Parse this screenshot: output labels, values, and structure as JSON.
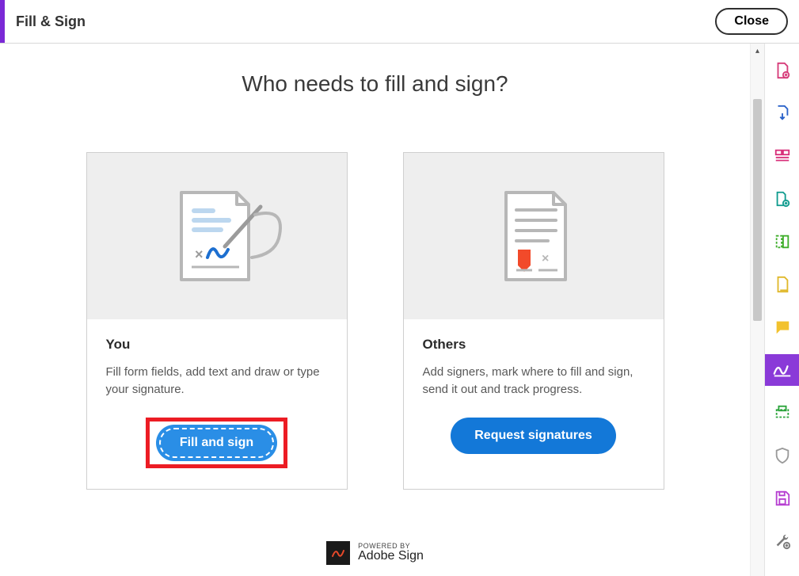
{
  "header": {
    "title": "Fill & Sign",
    "close_label": "Close"
  },
  "main": {
    "heading": "Who needs to fill and sign?",
    "cards": {
      "you": {
        "title": "You",
        "desc": "Fill form fields, add text and draw or type your signature.",
        "button": "Fill and sign"
      },
      "others": {
        "title": "Others",
        "desc": "Add signers, mark where to fill and sign, send it out and track progress.",
        "button": "Request signatures"
      }
    },
    "footer": {
      "powered": "POWERED BY",
      "brand": "Adobe Sign"
    }
  },
  "right_rail": {
    "icons": [
      "create-pdf-icon",
      "export-pdf-icon",
      "organize-pages-icon",
      "combine-files-icon",
      "compress-pdf-icon",
      "edit-pdf-icon",
      "comment-icon",
      "fill-sign-icon",
      "print-production-icon",
      "protect-icon",
      "save-icon",
      "more-tools-icon"
    ],
    "active": "fill-sign-icon"
  },
  "colors": {
    "accent_purple": "#8a3ad8",
    "button_blue": "#1378d8",
    "highlight_red": "#ec1c24"
  }
}
